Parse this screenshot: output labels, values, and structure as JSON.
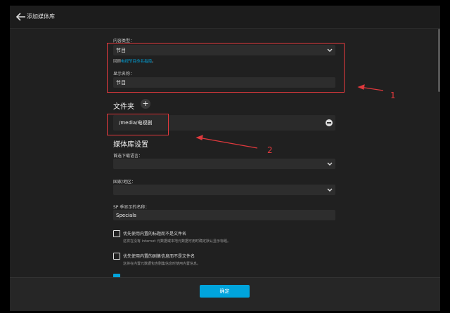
{
  "header": {
    "title": "添加媒体库"
  },
  "content_type": {
    "label": "内容类型：",
    "value": "节目"
  },
  "help": {
    "prefix": "回顾",
    "link": "电视节目命名指南",
    "suffix": "。"
  },
  "display_name": {
    "label": "显示名称：",
    "value": "节目"
  },
  "folders": {
    "heading": "文件夹",
    "add": "+",
    "items": [
      {
        "path": "/media/电视剧"
      }
    ]
  },
  "settings": {
    "heading": "媒体库设置",
    "language": {
      "label": "首选下载语言：",
      "value": ""
    },
    "country": {
      "label": "国家/地区：",
      "value": ""
    },
    "specials": {
      "label": "SP 季显示的名称：",
      "value": "Specials"
    },
    "opt1": {
      "label": "优先使用内置的标题而不是文件名",
      "hint": "这将在没有 internet 元数据或本地元数据可用时确定默认显示标题。",
      "checked": false
    },
    "opt2": {
      "label": "优先使用内置的剧集信息而不是文件名",
      "hint": "这将在内置元数据包含剧集信息时使用内置信息。",
      "checked": false
    },
    "opt3": {
      "checked": true
    }
  },
  "footer": {
    "ok": "确定"
  },
  "annotations": [
    "1",
    "2"
  ],
  "colors": {
    "accent": "#00a4dc",
    "annotation": "#e0393d"
  }
}
